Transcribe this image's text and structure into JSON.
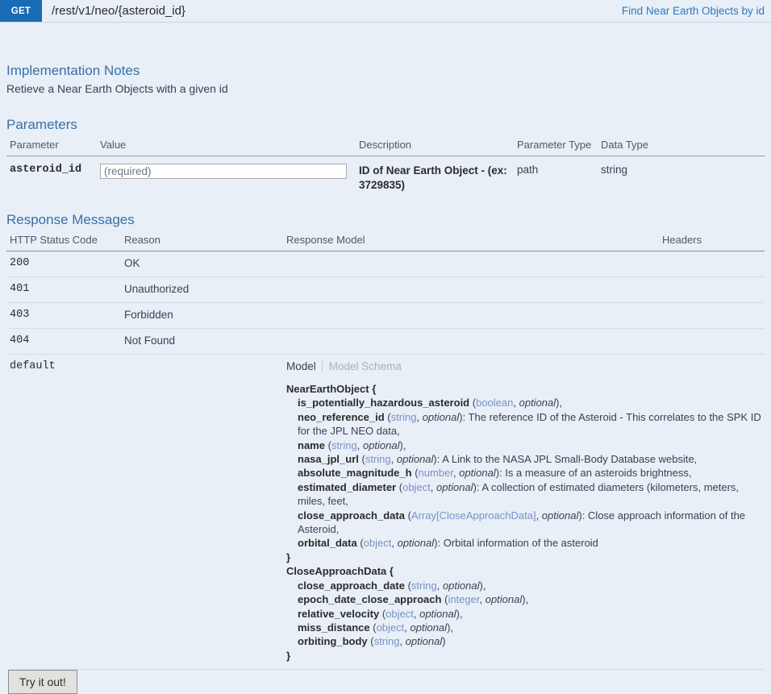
{
  "operation": {
    "method": "GET",
    "path": "/rest/v1/neo/{asteroid_id}",
    "summary_link": "Find Near Earth Objects by id"
  },
  "implementation_notes": {
    "title": "Implementation Notes",
    "text": "Retieve a Near Earth Objects with a given id"
  },
  "parameters_section": {
    "title": "Parameters",
    "headers": [
      "Parameter",
      "Value",
      "Description",
      "Parameter Type",
      "Data Type"
    ],
    "rows": [
      {
        "name": "asteroid_id",
        "value": "",
        "placeholder": "(required)",
        "description": "ID of Near Earth Object - (ex: 3729835)",
        "param_type": "path",
        "data_type": "string"
      }
    ]
  },
  "response_section": {
    "title": "Response Messages",
    "headers": [
      "HTTP Status Code",
      "Reason",
      "Response Model",
      "Headers"
    ],
    "rows": [
      {
        "code": "200",
        "reason": "OK"
      },
      {
        "code": "401",
        "reason": "Unauthorized"
      },
      {
        "code": "403",
        "reason": "Forbidden"
      },
      {
        "code": "404",
        "reason": "Not Found"
      }
    ],
    "default_row": {
      "code": "default",
      "reason": "",
      "tabs": {
        "model": "Model",
        "model_schema": "Model Schema",
        "active": "Model"
      },
      "models": [
        {
          "name": "NearEarthObject {",
          "close": "}",
          "properties": [
            {
              "name": "is_potentially_hazardous_asteroid",
              "type": "boolean",
              "flag": "optional",
              "desc": "",
              "tail": ","
            },
            {
              "name": "neo_reference_id",
              "type": "string",
              "flag": "optional",
              "desc": ": The reference ID of the Asteroid - This correlates to the SPK ID for the JPL NEO data,",
              "tail": ""
            },
            {
              "name": "name",
              "type": "string",
              "flag": "optional",
              "desc": "",
              "tail": ","
            },
            {
              "name": "nasa_jpl_url",
              "type": "string",
              "flag": "optional",
              "desc": ": A Link to the NASA JPL Small-Body Database website,",
              "tail": ""
            },
            {
              "name": "absolute_magnitude_h",
              "type": "number",
              "flag": "optional",
              "desc": ": Is a measure of an asteroids brightness,",
              "tail": ""
            },
            {
              "name": "estimated_diameter",
              "type": "object",
              "flag": "optional",
              "desc": ": A collection of estimated diameters (kilometers, meters, miles, feet,",
              "tail": ""
            },
            {
              "name": "close_approach_data",
              "type": "Array[CloseApproachData]",
              "flag": "optional",
              "desc": ": Close approach information of the Asteroid,",
              "tail": ""
            },
            {
              "name": "orbital_data",
              "type": "object",
              "flag": "optional",
              "desc": ": Orbital information of the asteroid",
              "tail": ""
            }
          ]
        },
        {
          "name": "CloseApproachData {",
          "close": "}",
          "properties": [
            {
              "name": "close_approach_date",
              "type": "string",
              "flag": "optional",
              "desc": "",
              "tail": ","
            },
            {
              "name": "epoch_date_close_approach",
              "type": "integer",
              "flag": "optional",
              "desc": "",
              "tail": ","
            },
            {
              "name": "relative_velocity",
              "type": "object",
              "flag": "optional",
              "desc": "",
              "tail": ","
            },
            {
              "name": "miss_distance",
              "type": "object",
              "flag": "optional",
              "desc": "",
              "tail": ","
            },
            {
              "name": "orbiting_body",
              "type": "string",
              "flag": "optional",
              "desc": "",
              "tail": ""
            }
          ]
        }
      ]
    }
  },
  "submit": {
    "label": "Try it out!"
  },
  "colors": {
    "method_badge": "#1a6bb5",
    "link": "#2f79c0",
    "section_title": "#3b6ea8",
    "background": "#e8eff7",
    "type_text": "#7a91c7"
  }
}
